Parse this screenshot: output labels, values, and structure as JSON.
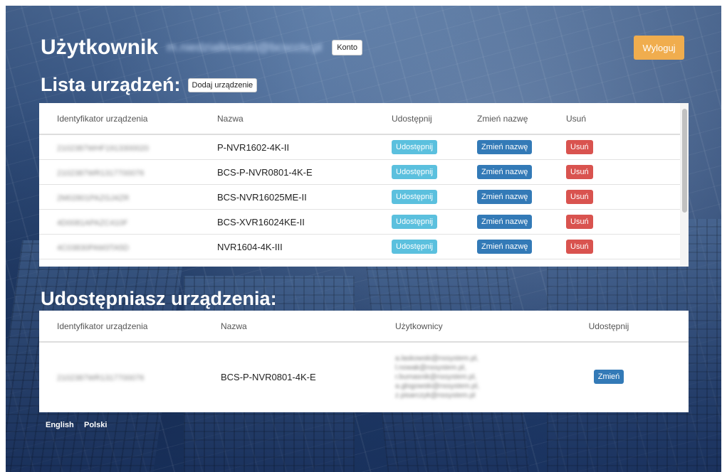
{
  "header": {
    "title": "Użytkownik",
    "email": "m.niedzialkowski@bcscctv.pl",
    "account_button": "Konto",
    "logout_button": "Wyloguj"
  },
  "devices": {
    "heading": "Lista urządzeń:",
    "add_button": "Dodaj urządzenie",
    "columns": [
      "Identyfikator urządzenia",
      "Nazwa",
      "Udostępnij",
      "Zmień nazwę",
      "Usuń"
    ],
    "share_label": "Udostępnij",
    "rename_label": "Zmień nazwę",
    "delete_label": "Usuń",
    "rows": [
      {
        "id": "2102387WHF1913300020",
        "name": "P-NVR1602-4K-II"
      },
      {
        "id": "2102387WR1317700076",
        "name": "BCS-P-NVR0801-4K-E"
      },
      {
        "id": "2M02801PAZGJ4ZR",
        "name": "BCS-NVR16025ME-II"
      },
      {
        "id": "4D0081APAZC410F",
        "name": "BCS-XVR16024KE-II"
      },
      {
        "id": "4C03830PAM3TA5D",
        "name": "NVR1604-4K-III"
      }
    ]
  },
  "shared": {
    "heading": "Udostępniasz urządzenia:",
    "columns": [
      "Identyfikator urządzenia",
      "Nazwa",
      "Użytkownicy",
      "Udostępnij"
    ],
    "rows": [
      {
        "id": "2102387WR1317700076",
        "name": "BCS-P-NVR0801-4K-E",
        "users": [
          "a.laskowski@nssystem.pl,",
          "l.nowak@nssystem.pl,",
          "r.bumasnik@nssystem.pl,",
          "a.glogowski@nssystem.pl,",
          "z.pisarczyk@nssystem.pl"
        ],
        "change_button": "Zmień"
      }
    ]
  },
  "footer": {
    "lang_en": "English",
    "lang_pl": "Polski"
  }
}
